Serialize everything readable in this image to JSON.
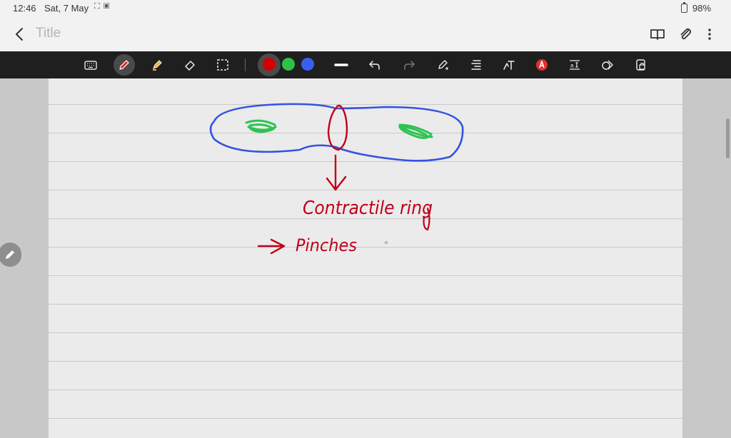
{
  "status_bar": {
    "time": "12:46",
    "date": "Sat, 7 May",
    "battery": "98%"
  },
  "title_bar": {
    "title": "Title"
  },
  "toolbar": {
    "tools": [
      "keyboard-icon",
      "pen-icon",
      "highlighter-icon",
      "eraser-icon",
      "lasso-select-icon"
    ],
    "active_tool": "pen-icon",
    "pen_colors": [
      "#d40000",
      "#2fbf4a",
      "#3a5ff0"
    ],
    "selected_color": "#d40000"
  },
  "colors": {
    "toolbar_bg": "#1f1f1f",
    "ink_blue": "#3552e0",
    "ink_red": "#c0001a",
    "ink_green": "#2ec352"
  },
  "handwriting": {
    "label_1": "Contractile ring",
    "label_2": "Pinches"
  }
}
